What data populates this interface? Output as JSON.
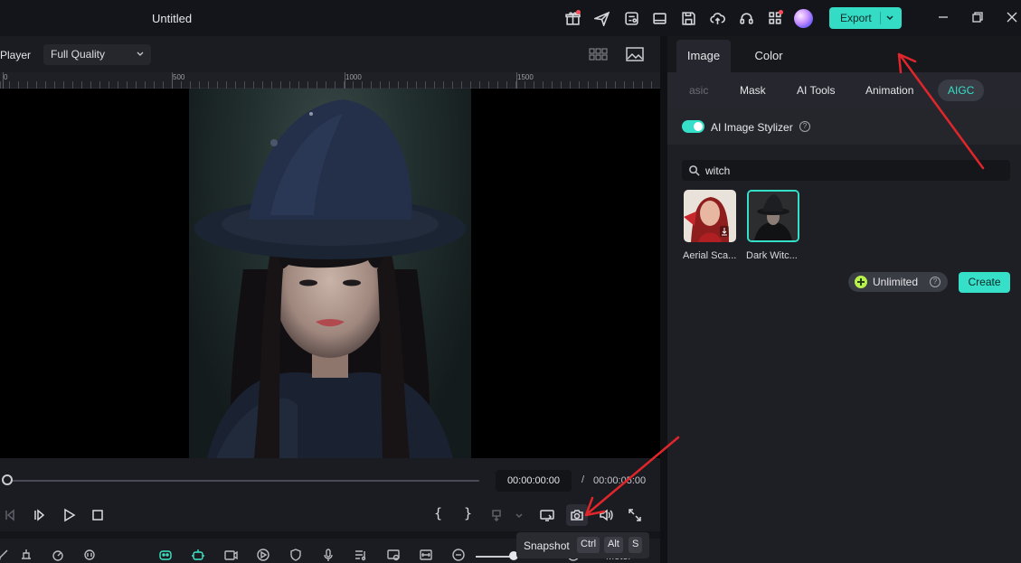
{
  "app": {
    "title": "Untitled",
    "export_label": "Export"
  },
  "player": {
    "label": "Player",
    "quality": "Full Quality",
    "ruler_labels": [
      "0",
      "500",
      "1000",
      "1500"
    ],
    "current_time": "00:00:00:00",
    "time_separator": "/",
    "total_time": "00:00:05:00"
  },
  "tooltip": {
    "label": "Snapshot",
    "keys": [
      "Ctrl",
      "Alt",
      "S"
    ]
  },
  "bottombar": {
    "meter_label": "Meter"
  },
  "right_panel": {
    "tabs": [
      "Image",
      "Color"
    ],
    "subtabs": [
      "asic",
      "Mask",
      "AI Tools",
      "Animation",
      "AIGC"
    ],
    "feature_label": "AI Image Stylizer",
    "search_value": "witch",
    "styles": [
      {
        "label": "Aerial Sca..."
      },
      {
        "label": "Dark Witc..."
      }
    ],
    "unlimited_label": "Unlimited",
    "create_label": "Create"
  },
  "colors": {
    "accent": "#35dfc8",
    "annotation": "#e0262b"
  }
}
